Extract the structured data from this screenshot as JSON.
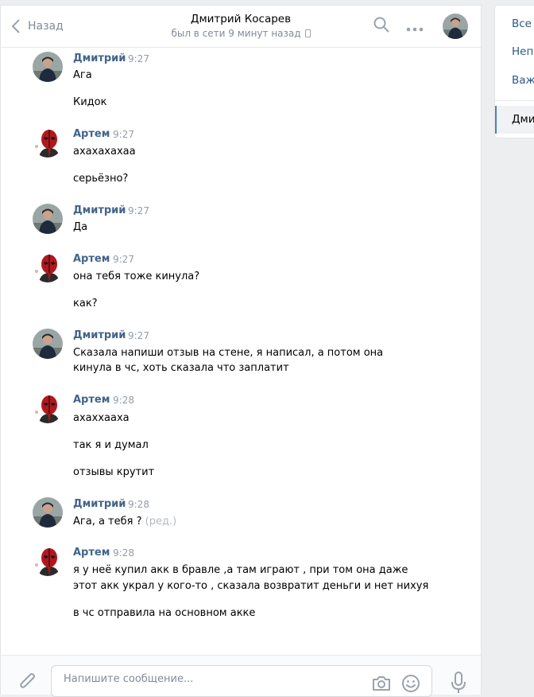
{
  "header": {
    "back_label": "Назад",
    "name": "Дмитрий Косарев",
    "status": "был в сети 9 минут назад"
  },
  "groups": [
    {
      "sender": "Дмитрий",
      "time": "9:27",
      "lines": [
        "Ага",
        "Кидок"
      ]
    },
    {
      "sender": "Артем",
      "time": "9:27",
      "lines": [
        "ахахахахаа",
        "серьёзно?"
      ]
    },
    {
      "sender": "Дмитрий",
      "time": "9:27",
      "lines": [
        "Да"
      ]
    },
    {
      "sender": "Артем",
      "time": "9:27",
      "lines": [
        "она тебя тоже кинула?",
        "как?"
      ]
    },
    {
      "sender": "Дмитрий",
      "time": "9:27",
      "lines": [
        "Сказала напиши отзыв на стене, я написал, а потом она",
        "кинула в чс, хоть сказала что заплатит"
      ]
    },
    {
      "sender": "Артем",
      "time": "9:28",
      "lines": [
        "ахаххааха",
        "так я и думал",
        "отзывы крутит"
      ]
    },
    {
      "sender": "Дмитрий",
      "time": "9:28",
      "lines": [
        "Ага, а тебя ?"
      ],
      "edited": "(ред.)"
    },
    {
      "sender": "Артем",
      "time": "9:28",
      "lines": [
        "я у неё купил акк в бравле ,а там играют , при том она даже",
        "этот акк украл у кого-то , сказала возвратит деньги и нет нихуя",
        "в чс отправила на основном акке"
      ]
    }
  ],
  "composer": {
    "placeholder": "Напишите сообщение..."
  },
  "sidebar": {
    "items": [
      "Все",
      "Непр",
      "Важ",
      "Дми"
    ]
  },
  "colors": {
    "accent": "#5181b8",
    "name": "#42648b",
    "link": "#2a5885",
    "muted": "#828a99"
  }
}
